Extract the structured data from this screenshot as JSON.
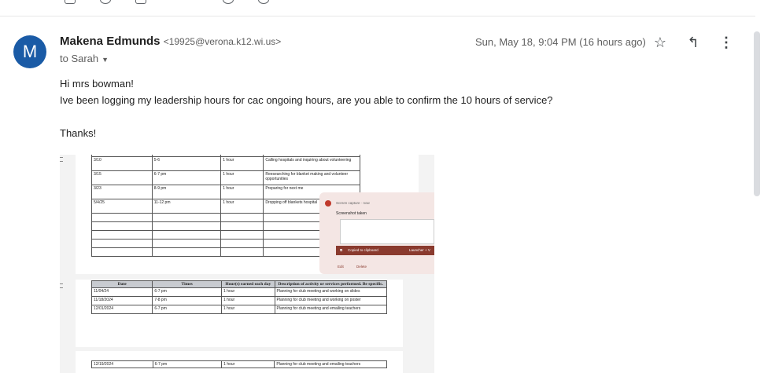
{
  "sender": {
    "initial": "M",
    "name": "Makena Edmunds",
    "email": "<19925@verona.k12.wi.us>",
    "to_label": "to Sarah",
    "date": "Sun, May 18, 9:04 PM (16 hours ago)",
    "avatar_color": "#1a5ba6"
  },
  "body": {
    "greeting": "Hi mrs bowman!",
    "line1": "Ive been logging my leadership hours for cac ongoing hours, are you able to confirm the 10 hours of service?",
    "signoff": "Thanks!"
  },
  "icons": {
    "star": "star-icon",
    "reply": "reply-icon",
    "more": "more-vert-icon",
    "caret": "chevron-down-icon"
  },
  "attachment": {
    "table1_rows": [
      [
        "3/10",
        "5-6",
        "1 hour",
        "Calling hospitals and inquiring about volunteering"
      ],
      [
        "3/15",
        "6-7 pm",
        "1 hour",
        "Reesearching for blanket making and volunteer opportunities"
      ],
      [
        "3/23",
        "8-9 pm",
        "1 hour",
        "Preparing for next me"
      ],
      [
        "5/4/25",
        "11-12 pm",
        "1 hour",
        "Dropping off blankets hospital"
      ]
    ],
    "toast": {
      "capture": "Screen capture · now",
      "taken": "Screenshot taken",
      "copied": "Copied to clipboard",
      "launcher": "Launcher + V",
      "edit": "Edit",
      "delete": "Delete"
    },
    "table2_headers": [
      "Date",
      "Times",
      "Hour(s) earned each day",
      "Description of activity or services performed. Be specific."
    ],
    "table2_rows": [
      [
        "11/04/24",
        "6-7 pm",
        "1 hour",
        "Planning for club meeting and working on slides"
      ],
      [
        "11/18/2024",
        "7-8 pm",
        "1 hour",
        "Planning for club meeting and working on poster"
      ],
      [
        "12/01/2024",
        "6-7 pm",
        "1 hour",
        "Planning for club meeting and emailing teachers"
      ]
    ],
    "table3_rows": [
      [
        "12/19/2024",
        "6-7 pm",
        "1 hour",
        "Planning for club meeting and emailing teachers"
      ]
    ]
  }
}
